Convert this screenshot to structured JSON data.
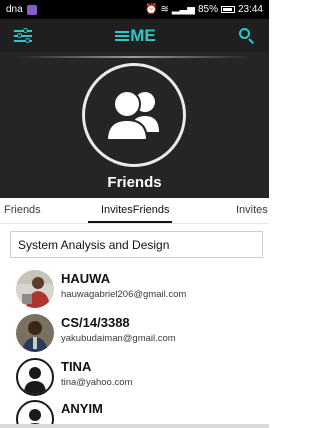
{
  "status_bar": {
    "carrier": "dna",
    "battery_percent": "85%",
    "time": "23:44",
    "icons": [
      "app-badge-icon",
      "alarm-icon",
      "wifi-icon",
      "signal-icon",
      "battery-icon"
    ]
  },
  "app_bar": {
    "logo_text": "ME",
    "left_icon": "filter-sliders-icon",
    "right_icon": "search-icon",
    "accent_color": "#2ec7c9"
  },
  "hero": {
    "title": "Friends",
    "icon": "group-people-icon"
  },
  "tabs": [
    {
      "label": "Friends"
    },
    {
      "label": "InvitesFriends",
      "active": true
    },
    {
      "label": "Invites"
    }
  ],
  "group_field": {
    "value": "System Analysis and Design"
  },
  "contacts": [
    {
      "name": "HAUWA",
      "email": "hauwagabriel206@gmail.com",
      "avatar": "photo"
    },
    {
      "name": "CS/14/3388",
      "email": "yakubudaiman@gmail.com",
      "avatar": "photo"
    },
    {
      "name": "TINA",
      "email": "tina@yahoo.com",
      "avatar": "default"
    },
    {
      "name": "ANYIM",
      "email": "",
      "avatar": "default"
    }
  ]
}
